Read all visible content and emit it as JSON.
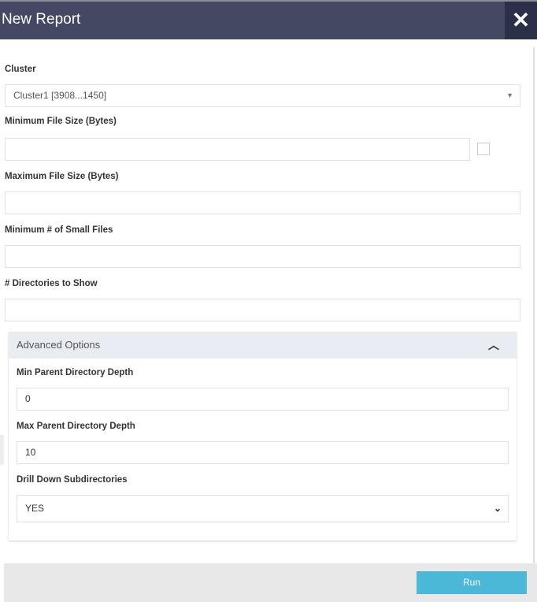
{
  "header": {
    "title": "New Report",
    "close_icon": "close-icon"
  },
  "form": {
    "cluster": {
      "label": "Cluster",
      "value": "Cluster1 [3908...1450]"
    },
    "min_file_size": {
      "label": "Minimum File Size (Bytes)",
      "value": ""
    },
    "max_file_size": {
      "label": "Maximum File Size (Bytes)",
      "value": ""
    },
    "min_small_files": {
      "label": "Minimum # of Small Files",
      "value": ""
    },
    "dirs_to_show": {
      "label": "# Directories to Show",
      "value": ""
    }
  },
  "advanced": {
    "title": "Advanced Options",
    "expanded": true,
    "min_depth": {
      "label": "Min Parent Directory Depth",
      "value": "0"
    },
    "max_depth": {
      "label": "Max Parent Directory Depth",
      "value": "10"
    },
    "drill_down": {
      "label": "Drill Down Subdirectories",
      "value": "YES"
    }
  },
  "footer": {
    "run_label": "Run"
  },
  "colors": {
    "header": "#444862",
    "run_button": "#4bb8d8"
  }
}
